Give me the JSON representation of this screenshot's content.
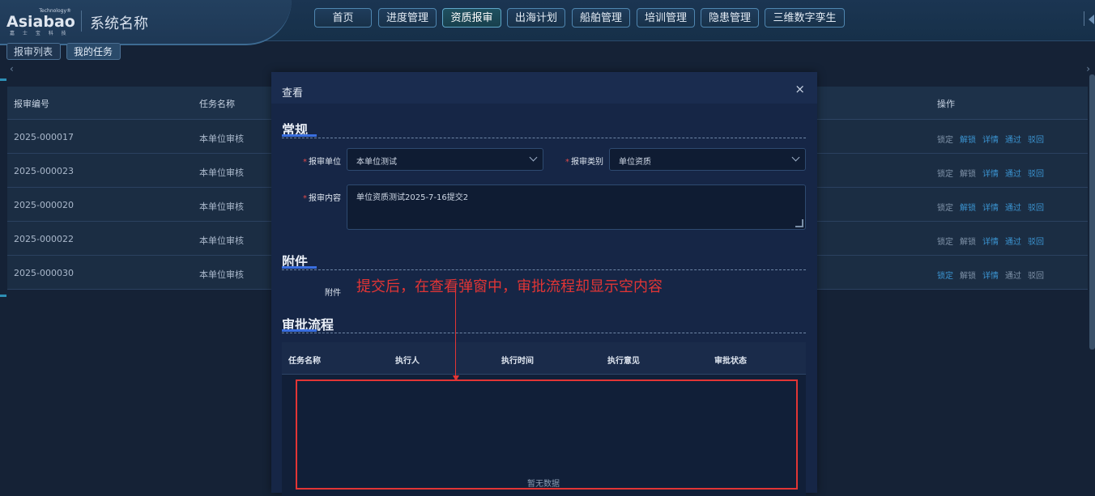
{
  "brand": {
    "logo_main": "Asiabao",
    "logo_tech": "Technology®",
    "logo_sub": "嘉 士 宝 科 技",
    "system_name": "系统名称"
  },
  "nav": {
    "items": [
      "首页",
      "进度管理",
      "资质报审",
      "出海计划",
      "船舶管理",
      "培训管理",
      "隐患管理",
      "三维数字孪生"
    ],
    "active": "资质报审"
  },
  "subtabs": [
    "报审列表",
    "我的任务"
  ],
  "table": {
    "headers": [
      "报审编号",
      "任务名称",
      "操作"
    ],
    "rows": [
      {
        "id": "2025-000017",
        "task": "本单位审核"
      },
      {
        "id": "2025-000023",
        "task": "本单位审核"
      },
      {
        "id": "2025-000020",
        "task": "本单位审核"
      },
      {
        "id": "2025-000022",
        "task": "本单位审核"
      },
      {
        "id": "2025-000030",
        "task": "本单位审核"
      }
    ],
    "actions": [
      "锁定",
      "解锁",
      "详情",
      "通过",
      "驳回"
    ]
  },
  "modal": {
    "title": "查看",
    "close": "×",
    "section_general": "常规",
    "label_unit": "报审单位",
    "unit_value": "本单位测试",
    "label_category": "报审类别",
    "category_value": "单位资质",
    "label_content": "报审内容",
    "content_value": "单位资质测试2025-7-16提交2",
    "section_attachment": "附件",
    "label_attachment": "附件",
    "section_flow": "审批流程",
    "flow_headers": [
      "任务名称",
      "执行人",
      "执行时间",
      "执行意见",
      "审批状态"
    ],
    "empty_text": "暂无数据"
  },
  "annotation": {
    "text": "提交后，在查看弹窗中，审批流程却显示空内容",
    "color": "#e23535"
  },
  "colors": {
    "accent_blue": "#3a6fe0",
    "link_blue": "#3b94d1",
    "required_red": "#e04b4b"
  }
}
